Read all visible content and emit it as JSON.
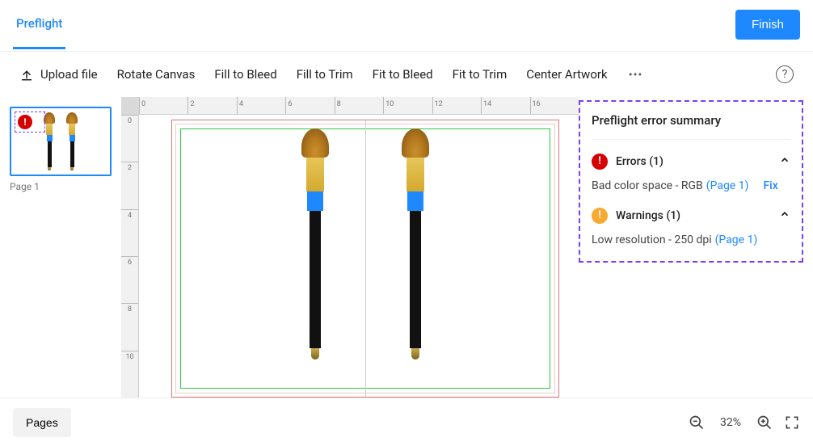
{
  "header": {
    "tab_label": "Preflight",
    "finish_label": "Finish"
  },
  "toolbar": {
    "upload_label": "Upload file",
    "rotate_label": "Rotate Canvas",
    "fill_bleed_label": "Fill to Bleed",
    "fill_trim_label": "Fill to Trim",
    "fit_bleed_label": "Fit to Bleed",
    "fit_trim_label": "Fit to Trim",
    "center_label": "Center Artwork"
  },
  "ruler": {
    "h_ticks": [
      "0",
      "2",
      "4",
      "6",
      "8",
      "10",
      "12",
      "14",
      "16"
    ],
    "v_ticks": [
      "0",
      "2",
      "4",
      "6",
      "8",
      "10"
    ]
  },
  "thumbnails": {
    "items": [
      {
        "label": "Page 1"
      }
    ]
  },
  "summary": {
    "title": "Preflight error summary",
    "errors_header": "Errors (1)",
    "error_text": "Bad color space - RGB",
    "error_page_link": "(Page 1)",
    "error_fix": "Fix",
    "warnings_header": "Warnings (1)",
    "warning_text": "Low resolution - 250 dpi",
    "warning_page_link": "(Page 1)"
  },
  "bottom": {
    "pages_label": "Pages",
    "zoom_value": "32%"
  }
}
